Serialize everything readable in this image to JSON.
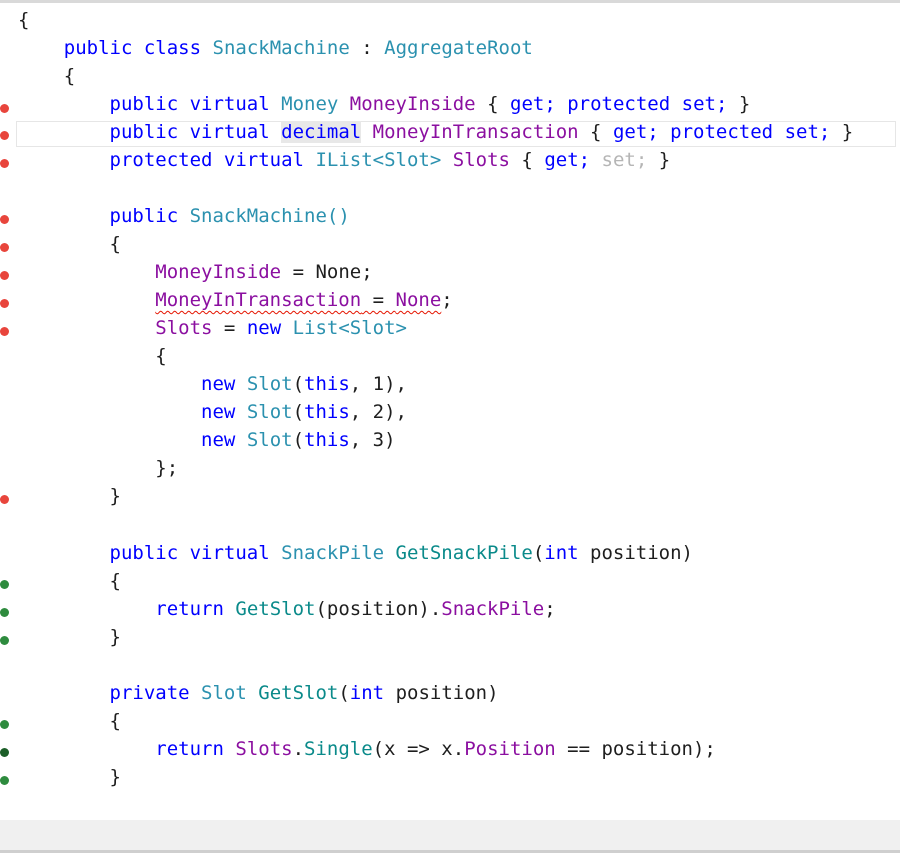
{
  "editor": {
    "lines": {
      "l01": "{",
      "l02": {
        "kw1": "public",
        "kw2": "class",
        "cls": "SnackMachine",
        "colon": ":",
        "base": "AggregateRoot"
      },
      "l03": "{",
      "l04": {
        "kw1": "public",
        "kw2": "virtual",
        "type": "Money",
        "prop": "MoneyInside",
        "open": "{",
        "get": "get;",
        "kw3": "protected",
        "set": "set;",
        "close": "}"
      },
      "l05": {
        "kw1": "public",
        "kw2": "virtual",
        "type": "decimal",
        "prop": "MoneyInTransaction",
        "open": "{",
        "get": "get;",
        "kw3": "protected",
        "set": "set;",
        "close": "}"
      },
      "l06": {
        "kw1": "protected",
        "kw2": "virtual",
        "type": "IList<Slot>",
        "prop": "Slots",
        "open": "{",
        "get": "get;",
        "set": "set;",
        "close": "}"
      },
      "l07": {
        "kw1": "public",
        "ctor": "SnackMachine()"
      },
      "l08": "{",
      "l09": {
        "prop": "MoneyInside",
        "rest": " = None;"
      },
      "l10": {
        "prop": "MoneyInTransaction",
        "eq": " = ",
        "none": "None",
        "semi": ";"
      },
      "l11": {
        "prop": "Slots",
        "eq": " = ",
        "kw": "new",
        "type": "List<Slot>"
      },
      "l12": "{",
      "l13": {
        "kw": "new",
        "type": "Slot",
        "open": "(",
        "this": "this",
        "rest": ", 1),"
      },
      "l14": {
        "kw": "new",
        "type": "Slot",
        "open": "(",
        "this": "this",
        "rest": ", 2),"
      },
      "l15": {
        "kw": "new",
        "type": "Slot",
        "open": "(",
        "this": "this",
        "rest": ", 3)"
      },
      "l16": "};",
      "l17": "}",
      "l18": {
        "kw1": "public",
        "kw2": "virtual",
        "type": "SnackPile",
        "method": "GetSnackPile",
        "open": "(",
        "kw3": "int",
        "rest": " position)"
      },
      "l19": "{",
      "l20": {
        "kw": "return",
        "method": "GetSlot",
        "mid": "(position).",
        "prop": "SnackPile",
        "semi": ";"
      },
      "l21": "}",
      "l22": {
        "kw1": "private",
        "type": "Slot",
        "method": "GetSlot",
        "open": "(",
        "kw2": "int",
        "rest": " position)"
      },
      "l23": "{",
      "l24": {
        "kw": "return",
        "prop1": "Slots",
        "dot": ".",
        "method": "Single",
        "mid": "(x => x.",
        "prop2": "Position",
        "rest": " == position);"
      },
      "l25": "}"
    }
  },
  "markers": {
    "red": "#e8453c",
    "green": "#2e8b3e",
    "dark_green": "#1c5e28"
  },
  "colors": {
    "keyword": "#0000ff",
    "type": "#2b91af",
    "property": "#8b0fa0",
    "method": "#0a8a8a"
  }
}
